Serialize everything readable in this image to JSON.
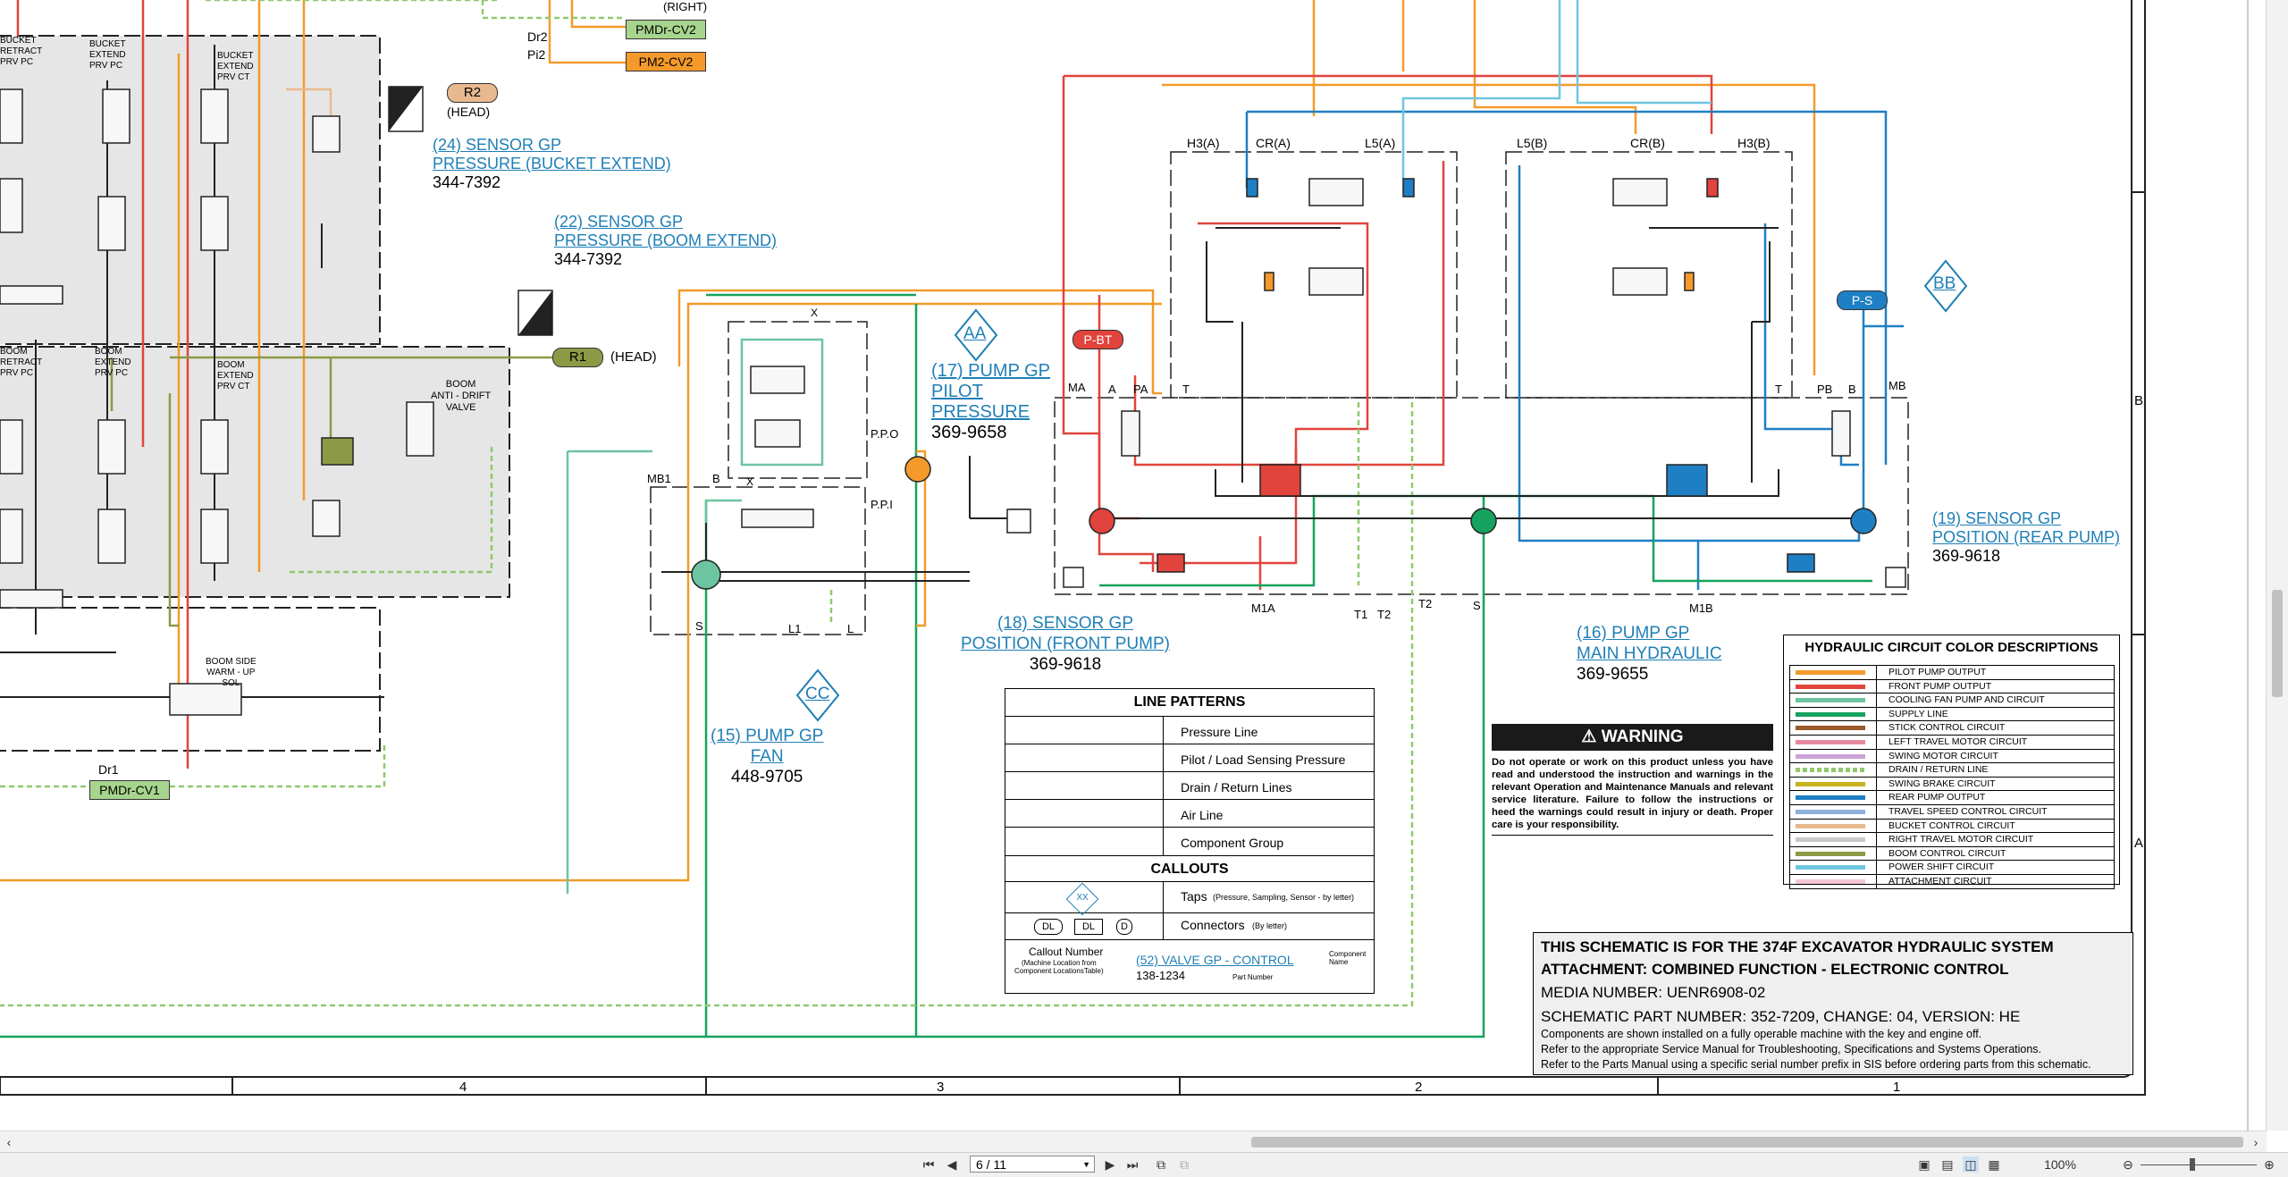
{
  "sheet": {
    "column_numbers": [
      "4",
      "3",
      "2",
      "1"
    ],
    "row_letters": [
      "B",
      "A"
    ]
  },
  "callouts": [
    {
      "id": "c24",
      "name": "(24) SENSOR GP\nPRESSURE (BUCKET EXTEND)",
      "part": "344-7392"
    },
    {
      "id": "c22",
      "name": "(22) SENSOR GP\nPRESSURE (BOOM EXTEND)",
      "part": "344-7392"
    },
    {
      "id": "c17",
      "name": "(17) PUMP GP\nPILOT\nPRESSURE",
      "part": "369-9658"
    },
    {
      "id": "c18",
      "name": "(18) SENSOR GP\nPOSITION (FRONT PUMP)",
      "part": "369-9618"
    },
    {
      "id": "c19",
      "name": "(19) SENSOR GP\nPOSITION (REAR PUMP)",
      "part": "369-9618"
    },
    {
      "id": "c16",
      "name": "(16) PUMP GP\nMAIN HYDRAULIC",
      "part": "369-9655"
    },
    {
      "id": "c15",
      "name": "(15) PUMP GP\nFAN",
      "part": "448-9705"
    }
  ],
  "tags": {
    "r2": "R2",
    "r2_head": "(HEAD)",
    "r1": "R1",
    "r1_head": "(HEAD)",
    "pmdr_cv2": "PMDr-CV2",
    "pm2_cv2": "PM2-CV2",
    "pmdr_cv1": "PMDr-CV1",
    "dr2": "Dr2",
    "pi2": "Pi2",
    "dr1": "Dr1",
    "p_bt": "P-BT",
    "p_s": "P-S",
    "aa": "AA",
    "bb": "BB",
    "cc": "CC",
    "right_partial": "(RIGHT)"
  },
  "valve_labels": {
    "bucket_retract": "BUCKET\nRETRACT\nPRV PC",
    "bucket_extend_pc": "BUCKET\nEXTEND\nPRV PC",
    "bucket_extend_ct": "BUCKET\nEXTEND\nPRV CT",
    "boom_retract": "BOOM\nRETRACT\nPRV PC",
    "boom_extend_pc": "BOOM\nEXTEND\nPRV PC",
    "boom_extend_ct": "BOOM\nEXTEND\nPRV CT",
    "boom_anti_drift": "BOOM\nANTI - DRIFT\nVALVE",
    "boom_side_warmup": "BOOM SIDE\nWARM - UP\nSOL"
  },
  "port_labels": {
    "h3a": "H3(A)",
    "cra": "CR(A)",
    "l5a": "L5(A)",
    "l5b": "L5(B)",
    "crb": "CR(B)",
    "h3b": "H3(B)",
    "ma": "MA",
    "a": "A",
    "pa": "PA",
    "t1": "T",
    "t2": "T",
    "pb": "PB",
    "b": "B",
    "mb": "MB",
    "m1a": "M1A",
    "m1b": "M1B",
    "tt1": "T1",
    "tt2": "T2",
    "ttt2": "T2",
    "s1": "S",
    "s2": "S",
    "mb1": "MB1",
    "bb1": "B",
    "xx": "X",
    "ppo": "P.P.O",
    "ppi": "P.P.I",
    "l1": "L1",
    "ll": "L",
    "xtop": "X"
  },
  "line_patterns": {
    "title": "LINE PATTERNS",
    "rows": [
      "Pressure Line",
      "Pilot / Load Sensing Pressure",
      "Drain / Return Lines",
      "Air Line",
      "Component Group"
    ],
    "callouts_title": "CALLOUTS",
    "taps_label": "Taps",
    "taps_note": "(Pressure, Sampling, Sensor - by letter)",
    "tap_letter": "XX",
    "connectors_label": "Connectors",
    "connectors_note": "(By letter)",
    "conn_dl1": "DL",
    "conn_dl2": "DL",
    "conn_d": "D",
    "callout_number": "Callout Number",
    "callout_number_note": "(Machine Location from\nComponent LocationsTable)",
    "example_callout": "(52) VALVE GP - CONTROL",
    "component_name": "Component\nName",
    "example_part": "138-1234",
    "part_number": "Part Number"
  },
  "warning": {
    "title": "WARNING",
    "text": "Do not operate or work on this product unless you have read and understood the instruction and warnings in the relevant Operation and Maintenance Manuals and relevant service literature. Failure to follow the instructions or heed the warnings could result in injury or death. Proper care is your responsibility."
  },
  "color_legend": {
    "title": "HYDRAULIC CIRCUIT COLOR DESCRIPTIONS",
    "items": [
      {
        "label": "PILOT PUMP OUTPUT",
        "color": "#f39a2a",
        "dashed": false
      },
      {
        "label": "FRONT PUMP OUTPUT",
        "color": "#e0443c",
        "dashed": false
      },
      {
        "label": "COOLING FAN PUMP AND CIRCUIT",
        "color": "#6cc4a0",
        "dashed": false
      },
      {
        "label": "SUPPLY LINE",
        "color": "#16a25f",
        "dashed": false
      },
      {
        "label": "STICK CONTROL CIRCUIT",
        "color": "#9b5a2a",
        "dashed": false
      },
      {
        "label": "LEFT TRAVEL MOTOR CIRCUIT",
        "color": "#e78aa0",
        "dashed": false
      },
      {
        "label": "SWING MOTOR CIRCUIT",
        "color": "#c9a3d6",
        "dashed": false
      },
      {
        "label": "DRAIN / RETURN LINE",
        "color": "#8fc96f",
        "dashed": true
      },
      {
        "label": "SWING BRAKE CIRCUIT",
        "color": "#c8b21e",
        "dashed": false
      },
      {
        "label": "REAR PUMP OUTPUT",
        "color": "#1f7fc4",
        "dashed": false
      },
      {
        "label": "TRAVEL SPEED CONTROL CIRCUIT",
        "color": "#8fb0dc",
        "dashed": false
      },
      {
        "label": "BUCKET CONTROL CIRCUIT",
        "color": "#e8b98f",
        "dashed": false
      },
      {
        "label": "RIGHT TRAVEL MOTOR CIRCUIT",
        "color": "#c9c9c9",
        "dashed": false
      },
      {
        "label": "BOOM CONTROL CIRCUIT",
        "color": "#8c9a45",
        "dashed": false
      },
      {
        "label": "POWER SHIFT CIRCUIT",
        "color": "#6fc6e0",
        "dashed": false
      },
      {
        "label": "ATTACHMENT CIRCUIT",
        "color": "#f4c6d4",
        "dashed": false
      }
    ]
  },
  "title_block": {
    "line1": "THIS SCHEMATIC IS FOR THE 374F EXCAVATOR HYDRAULIC SYSTEM",
    "line2": "ATTACHMENT: COMBINED FUNCTION - ELECTRONIC CONTROL",
    "media": "MEDIA NUMBER: UENR6908-02",
    "part": "SCHEMATIC PART NUMBER: 352-7209, CHANGE: 04, VERSION: HE",
    "note1": "Components are shown installed on a fully operable machine with the key and engine off.",
    "note2": "Refer to the appropriate Service Manual for Troubleshooting, Specifications and Systems Operations.",
    "note3": "Refer to the Parts Manual using a specific serial number prefix in SIS before ordering parts from this schematic."
  },
  "viewer": {
    "page_value": "6 / 11",
    "zoom": "100%",
    "colors": {
      "pilot": "#f39a2a",
      "front": "#e0443c",
      "rear": "#1f7fc4",
      "supply": "#16a25f",
      "fan": "#6cc4a0",
      "boom": "#8c9a45",
      "drain": "#8fc96f",
      "bucket": "#e8b98f",
      "powershift": "#6fc6e0"
    }
  }
}
